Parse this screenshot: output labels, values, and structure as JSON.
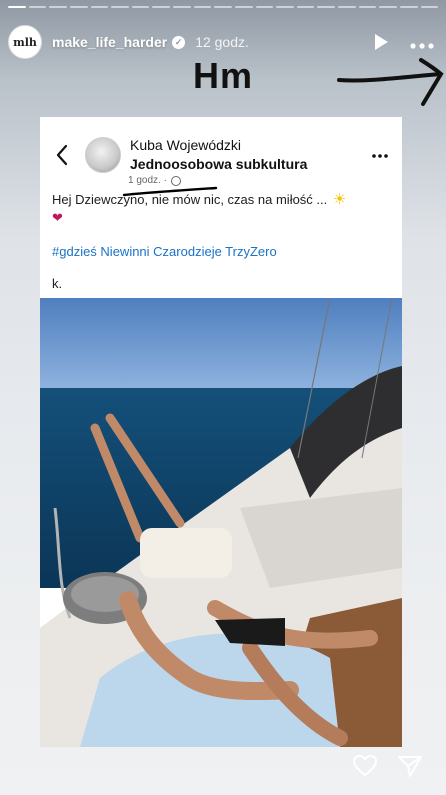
{
  "story": {
    "progress_segments": 21,
    "progress_done": 1,
    "account": {
      "avatar_text": "mlh",
      "username": "make_life_harder",
      "time_ago": "12 godz."
    },
    "overlay_text": "Hm",
    "icons": {
      "play": "play-icon",
      "more": "more-icon",
      "verified": "verified-badge-icon",
      "arrow": "hand-drawn-arrow-icon",
      "like": "heart-icon",
      "share": "send-icon"
    }
  },
  "post": {
    "author": "Kuba Wojewódzki",
    "group": "Jednoosobowa subkultura",
    "time": "1 godz. ·",
    "text": "Hej Dziewczyno, nie mów nic, czas na miłość ...",
    "hashtags": "#gdzieś Niewinni Czarodzieje TrzyZero",
    "signature": "k.",
    "emoji_sun": "☀",
    "emoji_heart": "❤"
  },
  "colors": {
    "hashtag": "#1a72c6",
    "sea": "#10476e",
    "sky": "#5a88c8"
  }
}
